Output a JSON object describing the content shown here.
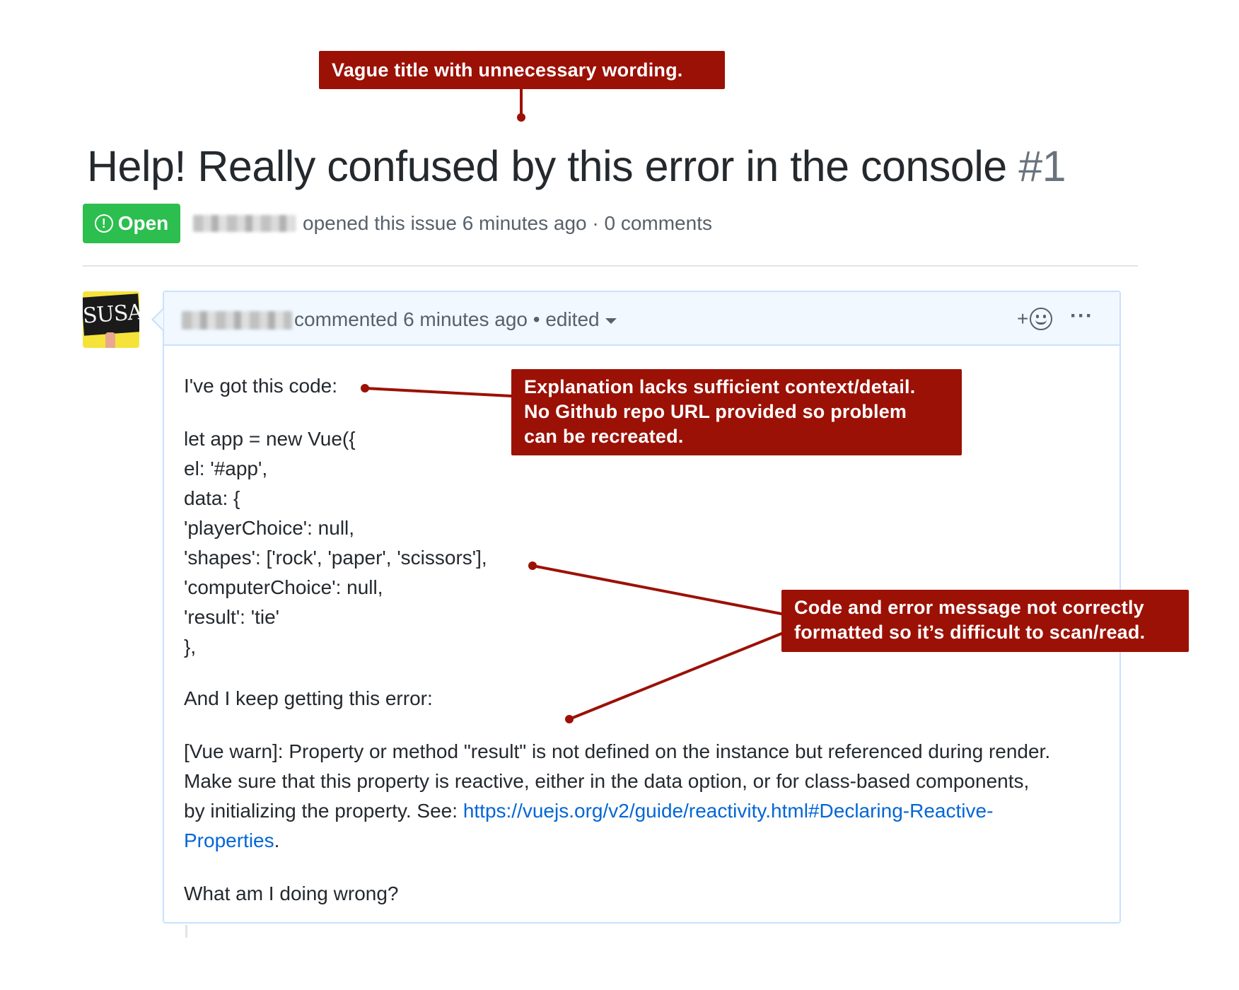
{
  "issue": {
    "title": "Help! Really confused by this error in the console",
    "number": "#1",
    "state": "Open",
    "state_icon": "!",
    "meta": "opened this issue 6 minutes ago · 0 comments"
  },
  "comment": {
    "avatar_text": "SUSAN",
    "meta": "commented 6 minutes ago • edited",
    "reaction_label": "+",
    "more_label": "···",
    "lines": [
      "I've got this code:",
      "let app = new Vue({",
      "el: '#app',",
      "data: {",
      "'playerChoice': null,",
      "'shapes': ['rock', 'paper', 'scissors'],",
      "'computerChoice': null,",
      "'result': 'tie'",
      "},",
      "And I keep getting this error:",
      "[Vue warn]: Property or method \"result\" is not defined on the instance but referenced during render.",
      "Make sure that this property is reactive, either in the data option, or for class-based components,",
      "by initializing the property. See: ",
      "What am I doing wrong?"
    ],
    "link_part1": "https://vuejs.org/v2/guide/reactivity.html#Declaring-Reactive-",
    "link_part2": "Properties",
    "link_suffix": "."
  },
  "annotations": {
    "title_note": "Vague title with unnecessary wording.",
    "explanation_note": [
      "Explanation lacks sufficient context/detail.",
      "No Github repo URL provided so problem",
      "can be recreated."
    ],
    "format_note": [
      "Code and error message not correctly",
      "formatted so it’s difficult to scan/read."
    ]
  },
  "colors": {
    "annotation": "#9b1106",
    "open_badge": "#2cbe4e",
    "link": "#0366d6",
    "header_bg": "#f1f8ff"
  }
}
